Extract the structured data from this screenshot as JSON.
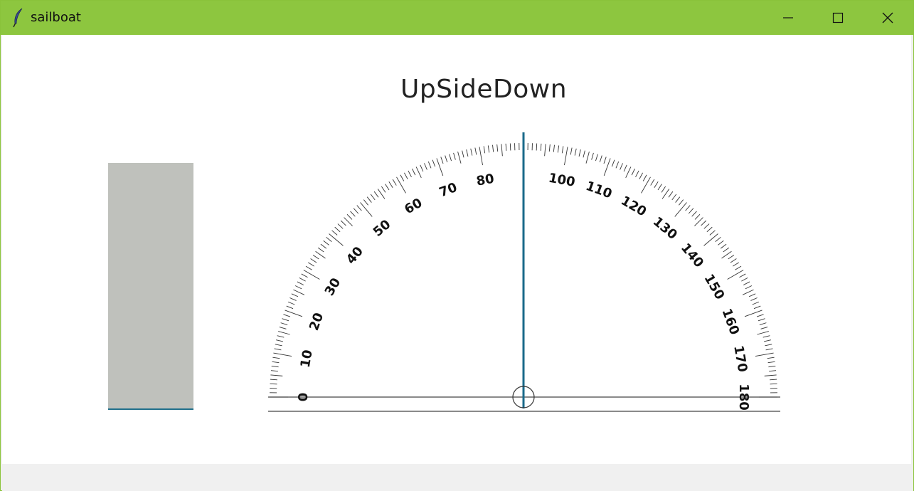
{
  "window": {
    "title": "sailboat",
    "icon": "feather-icon",
    "controls": {
      "minimize": "minimize-icon",
      "maximize": "maximize-icon",
      "close": "close-icon"
    }
  },
  "canvas": {
    "heading": "UpSideDown",
    "gauge_color": "#bfc1bc",
    "pointer_color": "#1a6a8a",
    "protractor": {
      "min_label": "0",
      "max_label": "180",
      "labels": [
        "10",
        "20",
        "30",
        "40",
        "50",
        "60",
        "70",
        "80",
        "100",
        "110",
        "120",
        "130",
        "140",
        "150",
        "160",
        "170"
      ],
      "label_values": [
        10,
        20,
        30,
        40,
        50,
        60,
        70,
        80,
        100,
        110,
        120,
        130,
        140,
        150,
        160,
        170
      ],
      "pointer_angle_deg": 90
    }
  },
  "colors": {
    "titlebar": "#8dc63f",
    "canvas": "#ffffff"
  }
}
